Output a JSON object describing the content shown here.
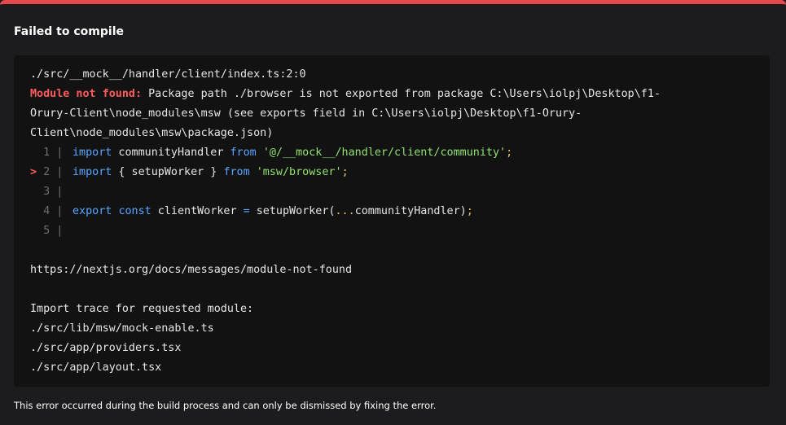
{
  "dialog": {
    "title": "Failed to compile",
    "footer": "This error occurred during the build process and can only be dismissed by fixing the error."
  },
  "error": {
    "file": "./src/__mock__/handler/client/index.ts:2:0",
    "label": "Module not found:",
    "message_line1": " Package path ./browser is not exported from package C:\\Users\\iolpj\\Desktop\\f1-",
    "message_line2": "Orury-Client\\node_modules\\msw (see exports field in C:\\Users\\iolpj\\Desktop\\f1-Orury-",
    "message_line3": "Client\\node_modules\\msw\\package.json)"
  },
  "code": {
    "lines": [
      {
        "num": "1",
        "marker": ""
      },
      {
        "num": "2",
        "marker": ">"
      },
      {
        "num": "3",
        "marker": ""
      },
      {
        "num": "4",
        "marker": ""
      },
      {
        "num": "5",
        "marker": ""
      }
    ],
    "pipe": "|",
    "l1": {
      "kw1": "import",
      "ident": " communityHandler ",
      "kw2": "from",
      "space": " ",
      "str": "'@/__mock__/handler/client/community'",
      "semi": ";"
    },
    "l2": {
      "kw1": "import",
      "ident": " { setupWorker } ",
      "kw2": "from",
      "space": " ",
      "str": "'msw/browser'",
      "semi": ";"
    },
    "l4": {
      "kw1": "export",
      "space1": " ",
      "kw2": "const",
      "ident": " clientWorker ",
      "op": "=",
      "call": " setupWorker(",
      "spread": "...",
      "arg": "communityHandler)",
      "semi": ";"
    }
  },
  "docs_link": "https://nextjs.org/docs/messages/module-not-found",
  "trace": {
    "header": "Import trace for requested module:",
    "items": [
      "./src/lib/msw/mock-enable.ts",
      "./src/app/providers.tsx",
      "./src/app/layout.tsx"
    ]
  },
  "colors": {
    "accent_bar": "#e5484d",
    "error_label": "#ff5c5c",
    "keyword": "#58a6ff",
    "string": "#8fe36e",
    "punctuation": "#e0c862"
  }
}
